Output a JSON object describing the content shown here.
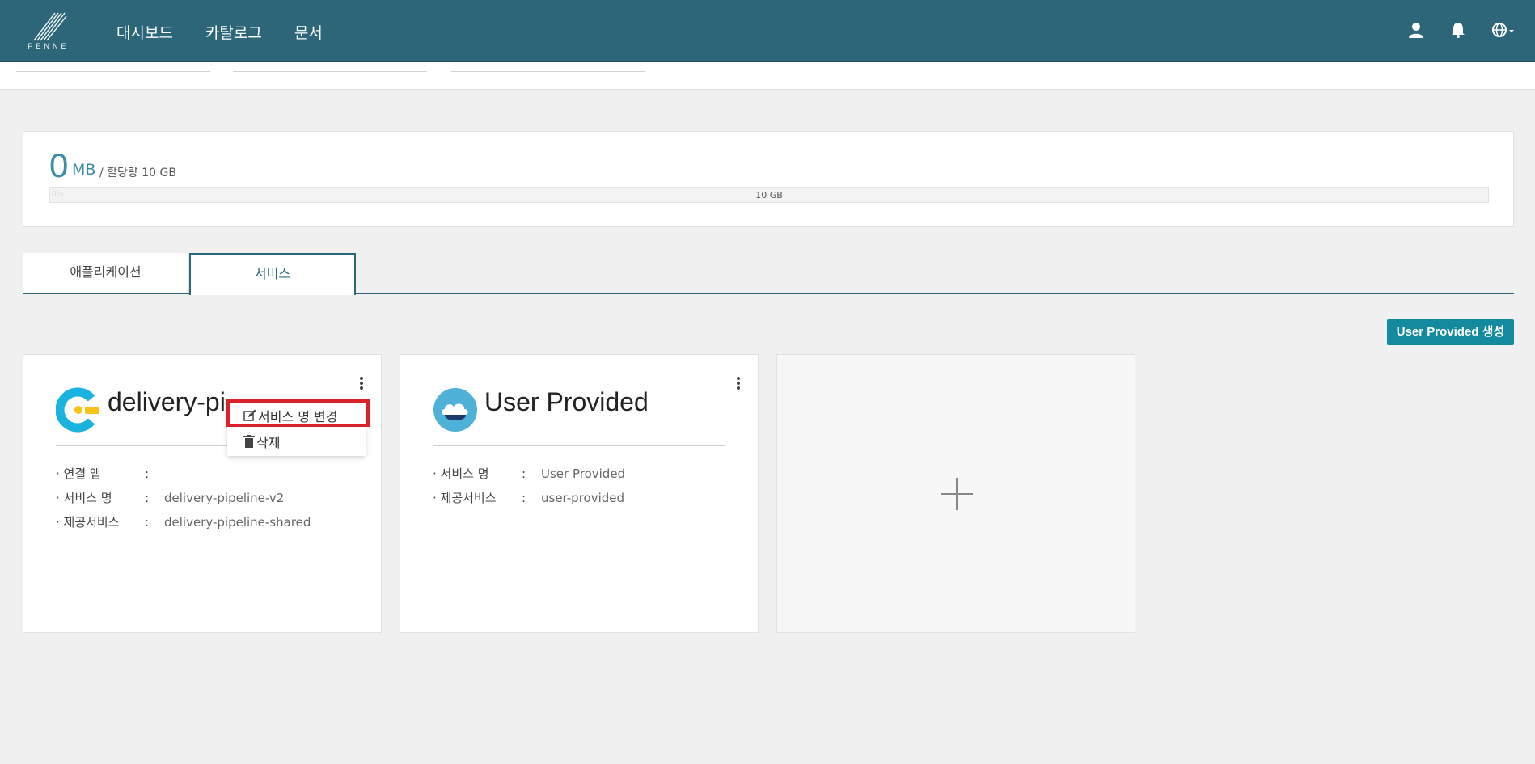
{
  "brand": {
    "logo_text": "PENNE"
  },
  "nav": {
    "items": [
      "대시보드",
      "카탈로그",
      "문서"
    ]
  },
  "header_icons": [
    "user-icon",
    "bell-icon",
    "globe-icon"
  ],
  "quota": {
    "used_value": "0",
    "used_unit": "MB",
    "allocation": "/ 할당량 10 GB",
    "bar_percent_label": "0%",
    "bar_total_label": "10 GB",
    "used_fraction": 0
  },
  "tabs": [
    {
      "label": "애플리케이션",
      "active": false
    },
    {
      "label": "서비스",
      "active": true
    }
  ],
  "create_button": "User Provided 생성",
  "cards": [
    {
      "title": "delivery-pipeline-v2",
      "title_visible": "delivery-pi",
      "icon": "delivery-pipeline-icon",
      "rows": [
        {
          "key": "· 연결 앱",
          "value": ""
        },
        {
          "key": "· 서비스 명",
          "value": "delivery-pipeline-v2"
        },
        {
          "key": "· 제공서비스",
          "value": "delivery-pipeline-shared"
        }
      ]
    },
    {
      "title": "User Provided",
      "icon": "cloud-icon",
      "rows": [
        {
          "key": "· 서비스 명",
          "value": "User Provided"
        },
        {
          "key": "· 제공서비스",
          "value": "user-provided"
        }
      ]
    }
  ],
  "row_colon": ":",
  "dropdown": {
    "rename_label": "서비스 명 변경",
    "delete_label": "삭제"
  },
  "colors": {
    "header": "#2c6678",
    "accent": "#3a8da5",
    "button": "#138a9e",
    "highlight": "#d9222a"
  }
}
